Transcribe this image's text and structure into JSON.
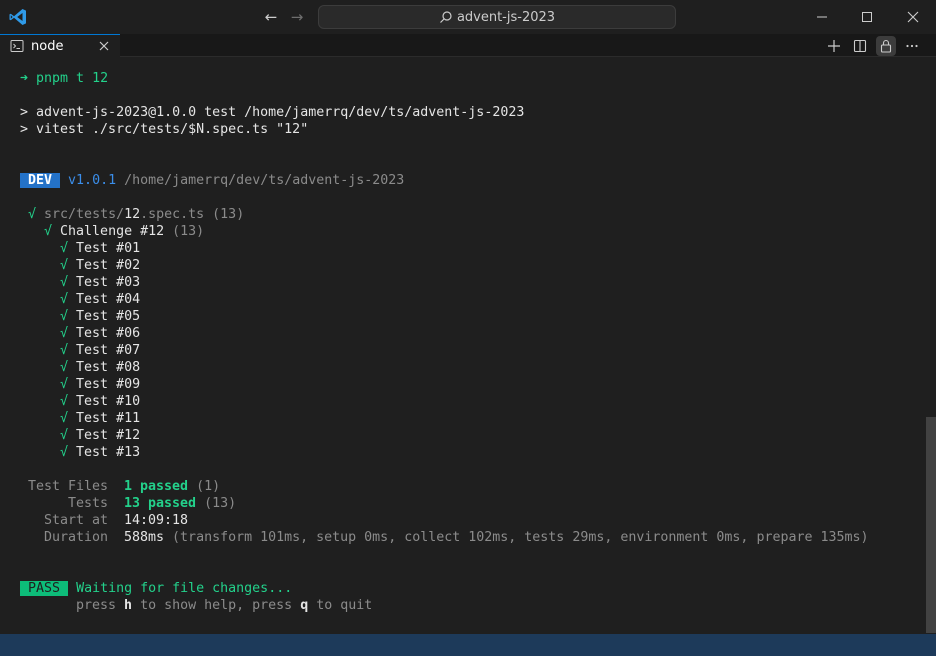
{
  "titlebar": {
    "command_center": "advent-js-2023",
    "back_glyph": "←",
    "forward_glyph": "→",
    "icons": [
      "vscode-logo",
      "search-icon",
      "minimize-icon",
      "maximize-icon",
      "close-icon"
    ]
  },
  "tab": {
    "label": "node",
    "icons": [
      "terminal-icon",
      "close-icon"
    ]
  },
  "tab_actions": [
    "plus-icon",
    "split-icon",
    "lock-icon",
    "ellipsis-icon"
  ],
  "terminal": {
    "prompt_arrow": "➜",
    "command": "pnpm t 12",
    "script_line1": "> advent-js-2023@1.0.0 test /home/jamerrq/dev/ts/advent-js-2023",
    "script_line2": "> vitest ./src/tests/$N.spec.ts \"12\"",
    "dev_badge": " DEV ",
    "version": "v1.0.1",
    "dev_path": "/home/jamerrq/dev/ts/advent-js-2023",
    "check": "√",
    "file_prefix": "src/tests/",
    "file_num": "12",
    "file_suffix": ".spec.ts",
    "file_count": "(13)",
    "suite_name": "Challenge #12",
    "suite_count": "(13)",
    "tests": [
      "Test #01",
      "Test #02",
      "Test #03",
      "Test #04",
      "Test #05",
      "Test #06",
      "Test #07",
      "Test #08",
      "Test #09",
      "Test #10",
      "Test #11",
      "Test #12",
      "Test #13"
    ],
    "summary": {
      "files_label": "Test Files",
      "files_passed": "1 passed",
      "files_total": "(1)",
      "tests_label": "Tests",
      "tests_passed": "13 passed",
      "tests_total": "(13)",
      "start_label": "Start at",
      "start_value": "14:09:18",
      "duration_label": "Duration",
      "duration_value": "588ms",
      "duration_detail": "(transform 101ms, setup 0ms, collect 102ms, tests 29ms, environment 0ms, prepare 135ms)"
    },
    "pass_badge": " PASS ",
    "waiting": "Waiting for file changes...",
    "help_press1": "press ",
    "help_key1": "h",
    "help_mid": " to show help, press ",
    "help_key2": "q",
    "help_end": " to quit"
  },
  "colors": {
    "background": "#1f1f1f",
    "green": "#23d18b",
    "dev_badge_bg": "#2472c8",
    "pass_badge_bg": "#0dbc79",
    "statusbar": "#1d3a5a"
  }
}
